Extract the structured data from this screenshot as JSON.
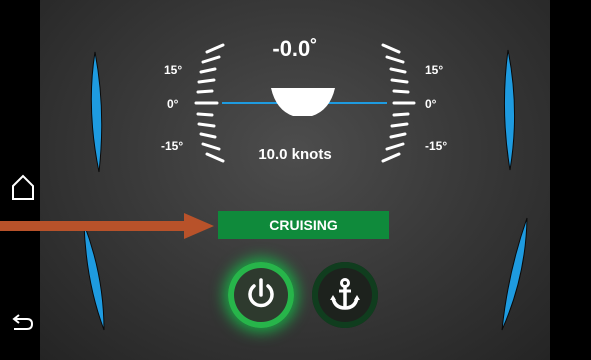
{
  "gauge": {
    "heading": "-0.0˚",
    "speed": "10.0 knots",
    "left_labels": {
      "top": "15°",
      "mid": "0°",
      "bottom": "-15°"
    },
    "right_labels": {
      "top": "15°",
      "mid": "0°",
      "bottom": "-15°"
    }
  },
  "status": {
    "label": "CRUISING"
  },
  "buttons": {
    "power": "power-icon",
    "anchor": "anchor-icon"
  },
  "nav": {
    "home": "home-icon",
    "back": "back-icon",
    "next": "right-arrow-icon"
  },
  "colors": {
    "accent_blue": "#1e9be0",
    "status_green": "#0f8a3b",
    "glow_green": "#27b54a",
    "arrow": "#b8522a"
  }
}
